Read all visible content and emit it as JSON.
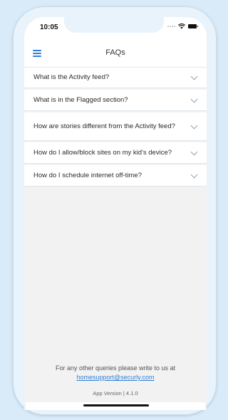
{
  "status_bar": {
    "time": "10:05",
    "icons": [
      "signal-dots",
      "wifi-icon",
      "battery-icon"
    ]
  },
  "header": {
    "title": "FAQs",
    "menu_icon": "hamburger-menu-icon"
  },
  "faqs": [
    {
      "question": "What is the Activity feed?"
    },
    {
      "question": "What is in the Flagged section?"
    },
    {
      "question": "How are stories different from the Activity feed?"
    },
    {
      "question": "How do I allow/block sites on my kid's device?"
    },
    {
      "question": "How do I schedule internet off-time?"
    }
  ],
  "footer": {
    "text": "For any other queries please write to us at",
    "email": "homesupport@securly.com",
    "version": "App Version | 4.1.0"
  },
  "colors": {
    "accent": "#2f7fd6",
    "background": "#f2f2f3",
    "page_bg": "#d9ebf8"
  }
}
